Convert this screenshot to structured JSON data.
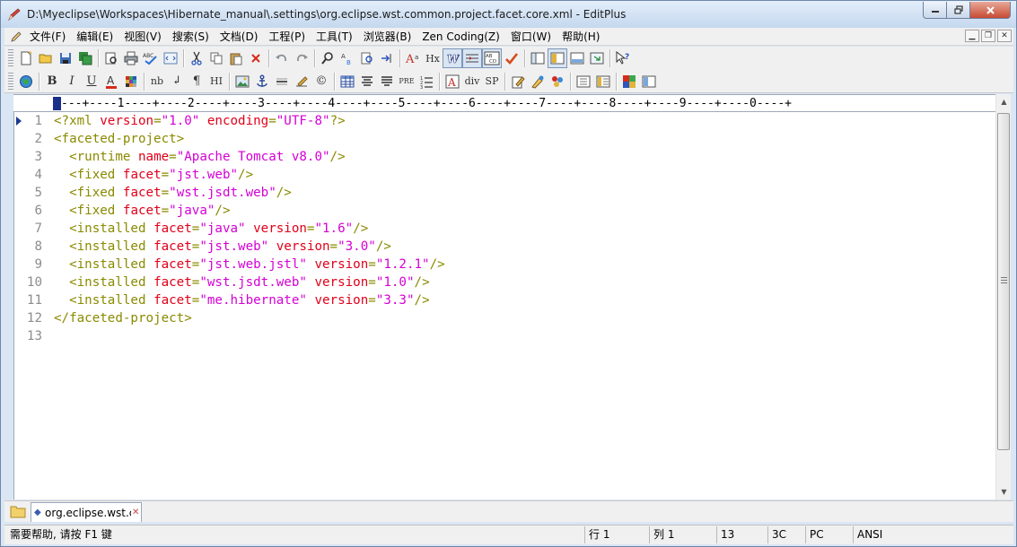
{
  "window": {
    "title": "D:\\Myeclipse\\Workspaces\\Hibernate_manual\\.settings\\org.eclipse.wst.common.project.facet.core.xml - EditPlus"
  },
  "menu": {
    "items": [
      {
        "label": "文件(F)"
      },
      {
        "label": "编辑(E)"
      },
      {
        "label": "视图(V)"
      },
      {
        "label": "搜索(S)"
      },
      {
        "label": "文档(D)"
      },
      {
        "label": "工程(P)"
      },
      {
        "label": "工具(T)"
      },
      {
        "label": "浏览器(B)"
      },
      {
        "label": "Zen Coding(Z)"
      },
      {
        "label": "窗口(W)"
      },
      {
        "label": "帮助(H)"
      }
    ]
  },
  "toolbar2_text": {
    "nb": "nb",
    "hx": "Hx",
    "hi": "HI",
    "pre": "PRE",
    "div": "div",
    "sp": "SP"
  },
  "ruler": "---+----1----+----2----+----3----+----4----+----5----+----6----+----7----+----8----+----9----+----0----+",
  "editor": {
    "lines": [
      {
        "n": "1",
        "indent": "",
        "parts": [
          [
            "punc",
            "<?"
          ],
          [
            "tag",
            "xml"
          ],
          [
            "txt",
            " "
          ],
          [
            "attr",
            "version"
          ],
          [
            "punc",
            "="
          ],
          [
            "val",
            "\"1.0\""
          ],
          [
            "txt",
            " "
          ],
          [
            "attr",
            "encoding"
          ],
          [
            "punc",
            "="
          ],
          [
            "val",
            "\"UTF-8\""
          ],
          [
            "punc",
            "?>"
          ]
        ]
      },
      {
        "n": "2",
        "indent": "",
        "parts": [
          [
            "punc",
            "<"
          ],
          [
            "tag",
            "faceted-project"
          ],
          [
            "punc",
            ">"
          ]
        ]
      },
      {
        "n": "3",
        "indent": "  ",
        "parts": [
          [
            "punc",
            "<"
          ],
          [
            "tag",
            "runtime"
          ],
          [
            "txt",
            " "
          ],
          [
            "attr",
            "name"
          ],
          [
            "punc",
            "="
          ],
          [
            "val",
            "\"Apache Tomcat v8.0\""
          ],
          [
            "punc",
            "/>"
          ]
        ]
      },
      {
        "n": "4",
        "indent": "  ",
        "parts": [
          [
            "punc",
            "<"
          ],
          [
            "tag",
            "fixed"
          ],
          [
            "txt",
            " "
          ],
          [
            "attr",
            "facet"
          ],
          [
            "punc",
            "="
          ],
          [
            "val",
            "\"jst.web\""
          ],
          [
            "punc",
            "/>"
          ]
        ]
      },
      {
        "n": "5",
        "indent": "  ",
        "parts": [
          [
            "punc",
            "<"
          ],
          [
            "tag",
            "fixed"
          ],
          [
            "txt",
            " "
          ],
          [
            "attr",
            "facet"
          ],
          [
            "punc",
            "="
          ],
          [
            "val",
            "\"wst.jsdt.web\""
          ],
          [
            "punc",
            "/>"
          ]
        ]
      },
      {
        "n": "6",
        "indent": "  ",
        "parts": [
          [
            "punc",
            "<"
          ],
          [
            "tag",
            "fixed"
          ],
          [
            "txt",
            " "
          ],
          [
            "attr",
            "facet"
          ],
          [
            "punc",
            "="
          ],
          [
            "val",
            "\"java\""
          ],
          [
            "punc",
            "/>"
          ]
        ]
      },
      {
        "n": "7",
        "indent": "  ",
        "parts": [
          [
            "punc",
            "<"
          ],
          [
            "tag",
            "installed"
          ],
          [
            "txt",
            " "
          ],
          [
            "attr",
            "facet"
          ],
          [
            "punc",
            "="
          ],
          [
            "val",
            "\"java\""
          ],
          [
            "txt",
            " "
          ],
          [
            "attr",
            "version"
          ],
          [
            "punc",
            "="
          ],
          [
            "val",
            "\"1.6\""
          ],
          [
            "punc",
            "/>"
          ]
        ]
      },
      {
        "n": "8",
        "indent": "  ",
        "parts": [
          [
            "punc",
            "<"
          ],
          [
            "tag",
            "installed"
          ],
          [
            "txt",
            " "
          ],
          [
            "attr",
            "facet"
          ],
          [
            "punc",
            "="
          ],
          [
            "val",
            "\"jst.web\""
          ],
          [
            "txt",
            " "
          ],
          [
            "attr",
            "version"
          ],
          [
            "punc",
            "="
          ],
          [
            "val",
            "\"3.0\""
          ],
          [
            "punc",
            "/>"
          ]
        ]
      },
      {
        "n": "9",
        "indent": "  ",
        "parts": [
          [
            "punc",
            "<"
          ],
          [
            "tag",
            "installed"
          ],
          [
            "txt",
            " "
          ],
          [
            "attr",
            "facet"
          ],
          [
            "punc",
            "="
          ],
          [
            "val",
            "\"jst.web.jstl\""
          ],
          [
            "txt",
            " "
          ],
          [
            "attr",
            "version"
          ],
          [
            "punc",
            "="
          ],
          [
            "val",
            "\"1.2.1\""
          ],
          [
            "punc",
            "/>"
          ]
        ]
      },
      {
        "n": "10",
        "indent": "  ",
        "parts": [
          [
            "punc",
            "<"
          ],
          [
            "tag",
            "installed"
          ],
          [
            "txt",
            " "
          ],
          [
            "attr",
            "facet"
          ],
          [
            "punc",
            "="
          ],
          [
            "val",
            "\"wst.jsdt.web\""
          ],
          [
            "txt",
            " "
          ],
          [
            "attr",
            "version"
          ],
          [
            "punc",
            "="
          ],
          [
            "val",
            "\"1.0\""
          ],
          [
            "punc",
            "/>"
          ]
        ]
      },
      {
        "n": "11",
        "indent": "  ",
        "parts": [
          [
            "punc",
            "<"
          ],
          [
            "tag",
            "installed"
          ],
          [
            "txt",
            " "
          ],
          [
            "attr",
            "facet"
          ],
          [
            "punc",
            "="
          ],
          [
            "val",
            "\"me.hibernate\""
          ],
          [
            "txt",
            " "
          ],
          [
            "attr",
            "version"
          ],
          [
            "punc",
            "="
          ],
          [
            "val",
            "\"3.3\""
          ],
          [
            "punc",
            "/>"
          ]
        ]
      },
      {
        "n": "12",
        "indent": "",
        "parts": [
          [
            "punc",
            "</"
          ],
          [
            "tag",
            "faceted-project"
          ],
          [
            "punc",
            ">"
          ]
        ]
      },
      {
        "n": "13",
        "indent": "",
        "parts": []
      }
    ]
  },
  "tabs": [
    {
      "label": "org.eclipse.wst.common.project.facet.core.xml"
    }
  ],
  "status": {
    "help": "需要帮助, 请按 F1 键",
    "row": "行 1",
    "col": "列 1",
    "lines": "13",
    "hex": "3C",
    "mode": "PC",
    "encoding": "ANSI"
  },
  "colors": {
    "tag": "#8a8a00",
    "attr": "#e0001a",
    "value": "#d400d4"
  }
}
